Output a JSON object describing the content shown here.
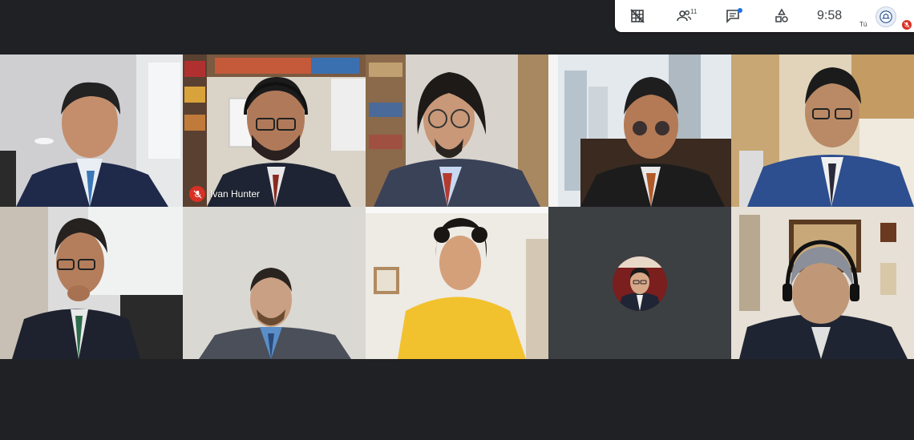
{
  "toolbar": {
    "icons": [
      "grid-off-icon",
      "people-icon",
      "chat-icon",
      "activities-icon"
    ],
    "participant_count": "11",
    "time": "9:58",
    "self_label": "Tú",
    "self_muted": true
  },
  "tiles": [
    {
      "id": "p1",
      "name": "",
      "muted": false
    },
    {
      "id": "p2",
      "name": "Ivan Hunter",
      "muted": true
    },
    {
      "id": "p3",
      "name": "",
      "muted": false
    },
    {
      "id": "p4",
      "name": "",
      "muted": false
    },
    {
      "id": "p5",
      "name": "",
      "muted": false
    },
    {
      "id": "p6",
      "name": "",
      "muted": false
    },
    {
      "id": "p7",
      "name": "",
      "muted": false
    },
    {
      "id": "p8",
      "name": "",
      "muted": false
    },
    {
      "id": "p9",
      "name": "",
      "muted": false,
      "camera_off": true
    },
    {
      "id": "p10",
      "name": "",
      "muted": false
    }
  ],
  "colors": {
    "background": "#202124",
    "toolbar": "#ffffff",
    "mute_red": "#d93025",
    "chat_dot": "#1a73e8"
  }
}
